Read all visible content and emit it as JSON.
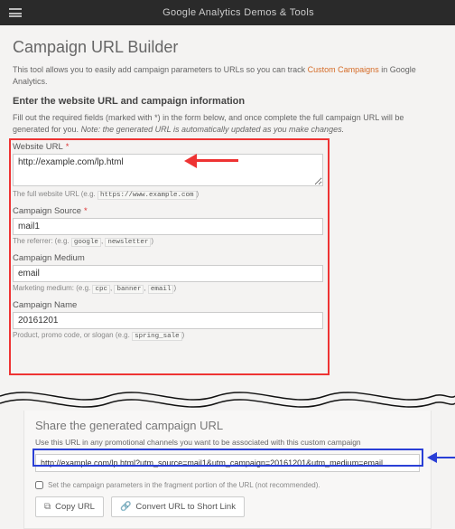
{
  "topbar": {
    "title": "Google Analytics Demos & Tools"
  },
  "page": {
    "title": "Campaign URL Builder",
    "intro_prefix": "This tool allows you to easily add campaign parameters to URLs so you can track ",
    "intro_link": "Custom Campaigns",
    "intro_suffix": " in Google Analytics.",
    "section_heading": "Enter the website URL and campaign information",
    "section_note_prefix": "Fill out the required fields (marked with *) in the form below, and once complete the full campaign URL will be generated for you. ",
    "section_note_em": "Note: the generated URL is automatically updated as you make changes."
  },
  "fields": {
    "website_url": {
      "label": "Website URL",
      "required": "*",
      "value": "http://example.com/lp.html",
      "hint_prefix": "The full website URL (e.g. ",
      "hint_code": "https://www.example.com",
      "hint_suffix": ")"
    },
    "campaign_source": {
      "label": "Campaign Source",
      "required": "*",
      "value": "mail1",
      "hint_prefix": "The referrer: (e.g. ",
      "hint_code1": "google",
      "hint_sep": ", ",
      "hint_code2": "newsletter",
      "hint_suffix": ")"
    },
    "campaign_medium": {
      "label": "Campaign Medium",
      "value": "email",
      "hint_prefix": "Marketing medium: (e.g. ",
      "hint_code1": "cpc",
      "hint_sep": ", ",
      "hint_code2": "banner",
      "hint_code3": "email",
      "hint_suffix": ")"
    },
    "campaign_name": {
      "label": "Campaign Name",
      "value": "20161201",
      "hint_prefix": "Product, promo code, or slogan (e.g. ",
      "hint_code": "spring_sale",
      "hint_suffix": ")"
    }
  },
  "share": {
    "title": "Share the generated campaign URL",
    "note": "Use this URL in any promotional channels you want to be associated with this custom campaign",
    "url": "http://example.com/lp.html?utm_source=mail1&utm_campaign=20161201&utm_medium=email",
    "fragment_label": "Set the campaign parameters in the fragment portion of the URL (not recommended).",
    "copy_btn": "Copy URL",
    "convert_btn": "Convert URL to Short Link"
  }
}
